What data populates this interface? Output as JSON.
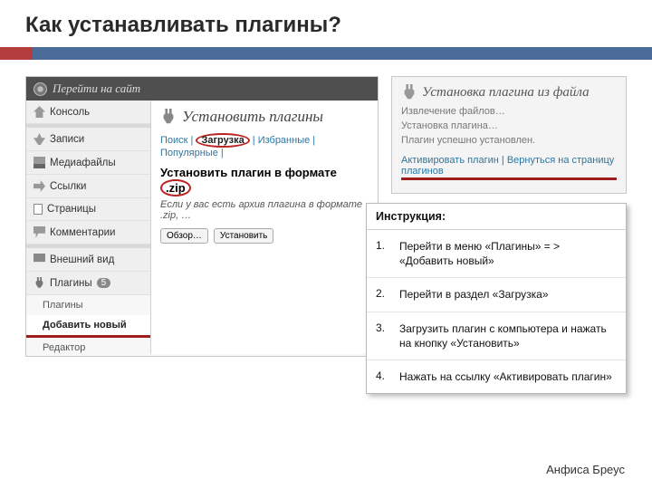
{
  "slide": {
    "title": "Как устанавливать плагины?",
    "author": "Анфиса Бреус"
  },
  "wp_header": {
    "site_link": "Перейти на сайт"
  },
  "sidebar": {
    "items": [
      {
        "label": "Консоль"
      },
      {
        "label": "Записи"
      },
      {
        "label": "Медиафайлы"
      },
      {
        "label": "Ссылки"
      },
      {
        "label": "Страницы"
      },
      {
        "label": "Комментарии"
      },
      {
        "label": "Внешний вид"
      },
      {
        "label": "Плагины",
        "badge": "5"
      }
    ],
    "sub_items": [
      {
        "label": "Плагины"
      },
      {
        "label": "Добавить новый",
        "active": true
      },
      {
        "label": "Редактор"
      }
    ]
  },
  "install_panel": {
    "heading": "Установить плагины",
    "tabs": {
      "search": "Поиск",
      "upload": "Загрузка",
      "featured": "Избранные",
      "popular": "Популярные"
    },
    "subheading_prefix": "Установить плагин в формате",
    "subheading_ext": ".zip",
    "subtext": "Если у вас есть архив плагина в формате .zip, …",
    "browse_btn": "Обзор…",
    "install_btn": "Установить"
  },
  "file_panel": {
    "heading": "Установка плагина из файла",
    "line1": "Извлечение файлов…",
    "line2": "Установка плагина…",
    "line3": "Плагин успешно установлен.",
    "link_activate": "Активировать плагин",
    "link_back": "Вернуться на страницу плагинов",
    "sep": " | "
  },
  "instructions": {
    "title": "Инструкция:",
    "steps": [
      {
        "n": "1.",
        "text": "Перейти в меню «Плагины» = > «Добавить новый»"
      },
      {
        "n": "2.",
        "text": "Перейти в раздел «Загрузка»"
      },
      {
        "n": "3.",
        "text": "Загрузить плагин с компьютера и нажать на кнопку «Установить»"
      },
      {
        "n": "4.",
        "text": "Нажать на ссылку «Активировать плагин»"
      }
    ]
  }
}
